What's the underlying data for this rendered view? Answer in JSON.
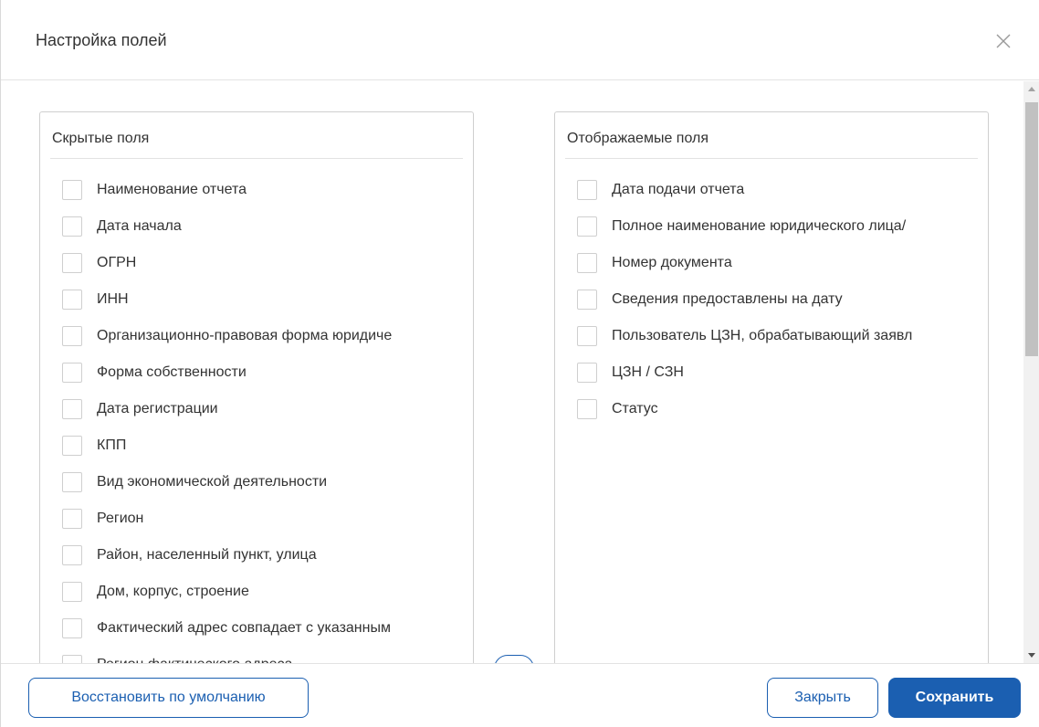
{
  "dialog": {
    "title": "Настройка полей",
    "close_icon": "close-x-icon"
  },
  "hidden_fields": {
    "title": "Скрытые поля",
    "items": [
      {
        "label": "Наименование отчета",
        "checked": false
      },
      {
        "label": "Дата начала",
        "checked": false
      },
      {
        "label": "ОГРН",
        "checked": false
      },
      {
        "label": "ИНН",
        "checked": false
      },
      {
        "label": "Организационно-правовая форма юридиче",
        "checked": false
      },
      {
        "label": "Форма собственности",
        "checked": false
      },
      {
        "label": "Дата регистрации",
        "checked": false
      },
      {
        "label": "КПП",
        "checked": false
      },
      {
        "label": "Вид экономической деятельности",
        "checked": false
      },
      {
        "label": "Регион",
        "checked": false
      },
      {
        "label": "Район, населенный пункт, улица",
        "checked": false
      },
      {
        "label": "Дом, корпус, строение",
        "checked": false
      },
      {
        "label": "Фактический адрес совпадает с указанным",
        "checked": false
      },
      {
        "label": "Регион фактического адреса",
        "checked": false
      }
    ]
  },
  "shown_fields": {
    "title": "Отображаемые поля",
    "items": [
      {
        "label": "Дата подачи отчета",
        "checked": false
      },
      {
        "label": "Полное наименование юридического лица/",
        "checked": false
      },
      {
        "label": "Номер документа",
        "checked": false
      },
      {
        "label": "Сведения предоставлены на дату",
        "checked": false
      },
      {
        "label": "Пользователь ЦЗН, обрабатывающий заявл",
        "checked": false
      },
      {
        "label": "ЦЗН / СЗН",
        "checked": false
      },
      {
        "label": "Статус",
        "checked": false
      }
    ]
  },
  "footer": {
    "restore_label": "Восстановить по умолчанию",
    "close_label": "Закрыть",
    "save_label": "Сохранить"
  },
  "colors": {
    "accent": "#1b5fb1",
    "border": "#cfcfcf",
    "text": "#333333"
  }
}
